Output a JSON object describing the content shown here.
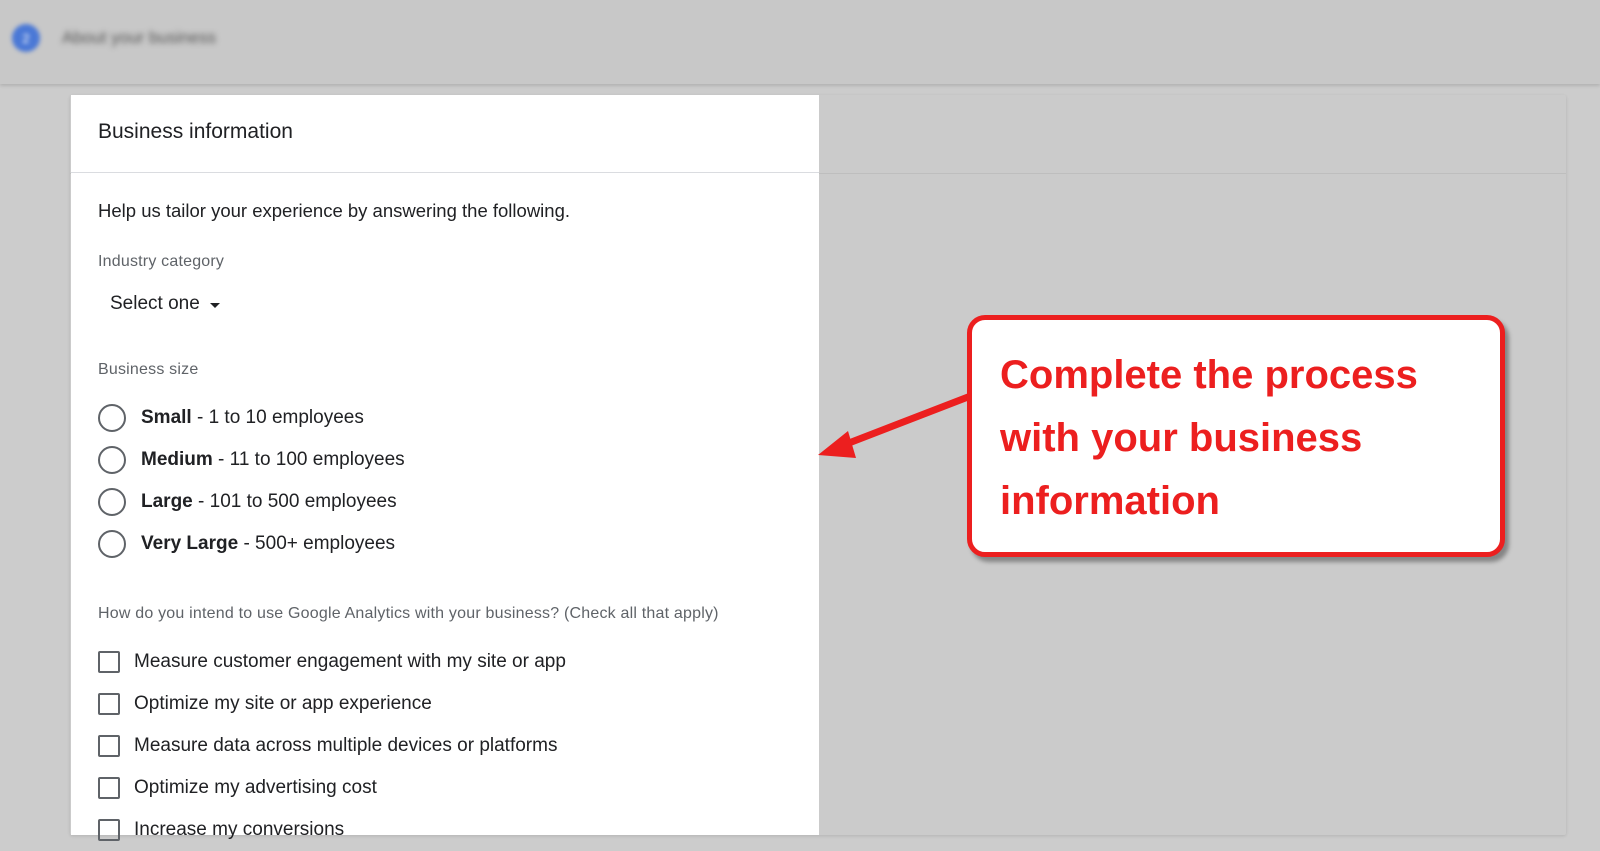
{
  "header": {
    "step_number": "2",
    "step_title": "About your business"
  },
  "card": {
    "title": "Business information",
    "intro": "Help us tailor your experience by answering the following.",
    "industry": {
      "label": "Industry category",
      "selected": "Select one"
    },
    "business_size": {
      "label": "Business size",
      "options": [
        {
          "name": "Small",
          "detail": " - 1 to 10 employees"
        },
        {
          "name": "Medium",
          "detail": " - 11 to 100 employees"
        },
        {
          "name": "Large",
          "detail": " - 101 to 500 employees"
        },
        {
          "name": "Very Large",
          "detail": " - 500+ employees"
        }
      ]
    },
    "usage": {
      "label": "How do you intend to use Google Analytics with your business? (Check all that apply)",
      "options": [
        "Measure customer engagement with my site or app",
        "Optimize my site or app experience",
        "Measure data across multiple devices or platforms",
        "Optimize my advertising cost",
        "Increase my conversions"
      ]
    }
  },
  "callout": {
    "lines": [
      "Complete the process",
      "with your business",
      "information"
    ]
  },
  "colors": {
    "accent_red": "#ec1f1f",
    "step_blue": "#4a78d6",
    "overlay_gray": "#cccccc"
  }
}
